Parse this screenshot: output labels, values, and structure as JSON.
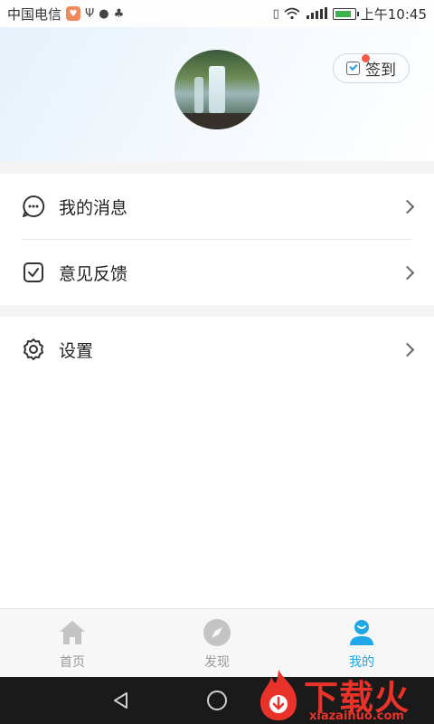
{
  "status_bar": {
    "carrier": "中国电信",
    "time": "上午10:45"
  },
  "header": {
    "checkin_label": "签到"
  },
  "menu": {
    "messages_label": "我的消息",
    "feedback_label": "意见反馈",
    "settings_label": "设置"
  },
  "tabbar": {
    "tabs": [
      {
        "label": "首页",
        "icon": "home-icon"
      },
      {
        "label": "发现",
        "icon": "compass-icon"
      },
      {
        "label": "我的",
        "icon": "user-icon"
      }
    ],
    "active_index": 2
  },
  "watermark": {
    "title": "下载火",
    "url": "xiazaihuo.com"
  },
  "colors": {
    "accent": "#1fa7e8",
    "badge_dot": "#f25b4b",
    "watermark": "#e9332a"
  }
}
